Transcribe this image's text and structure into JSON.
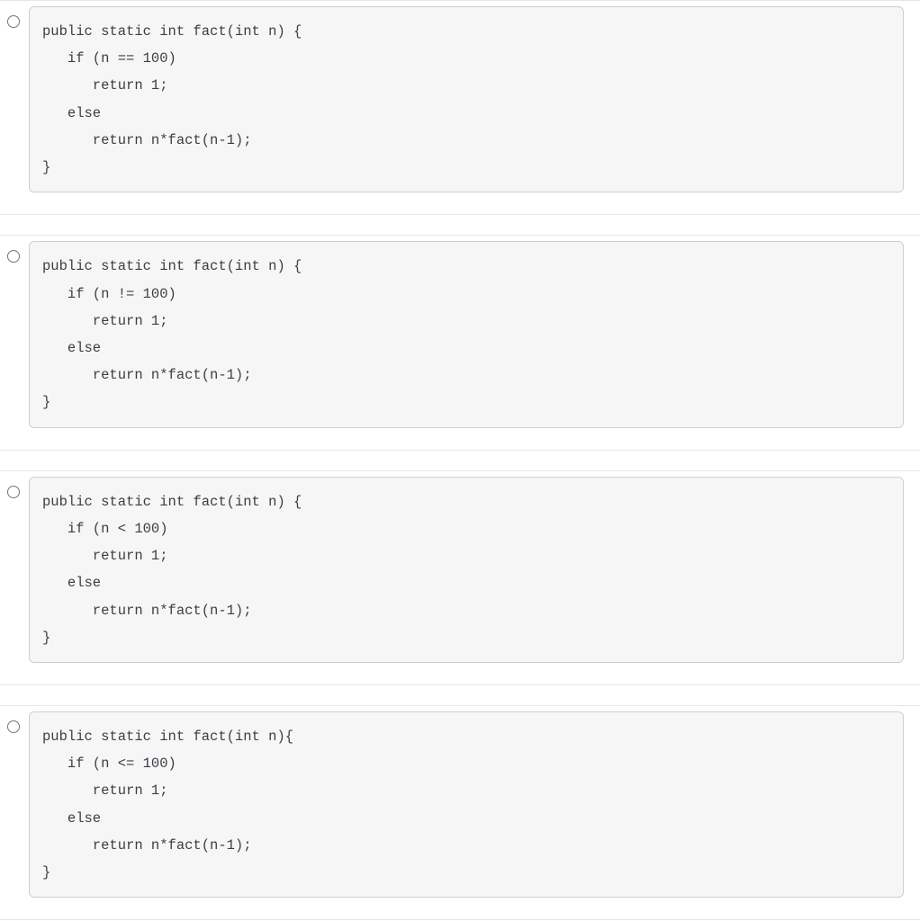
{
  "options": [
    {
      "code": "public static int fact(int n) {\n   if (n == 100)\n      return 1;\n   else\n      return n*fact(n-1);\n}"
    },
    {
      "code": "public static int fact(int n) {\n   if (n != 100)\n      return 1;\n   else\n      return n*fact(n-1);\n}"
    },
    {
      "code": "public static int fact(int n) {\n   if (n < 100)\n      return 1;\n   else\n      return n*fact(n-1);\n}"
    },
    {
      "code": "public static int fact(int n){\n   if (n <= 100)\n      return 1;\n   else\n      return n*fact(n-1);\n}"
    }
  ]
}
